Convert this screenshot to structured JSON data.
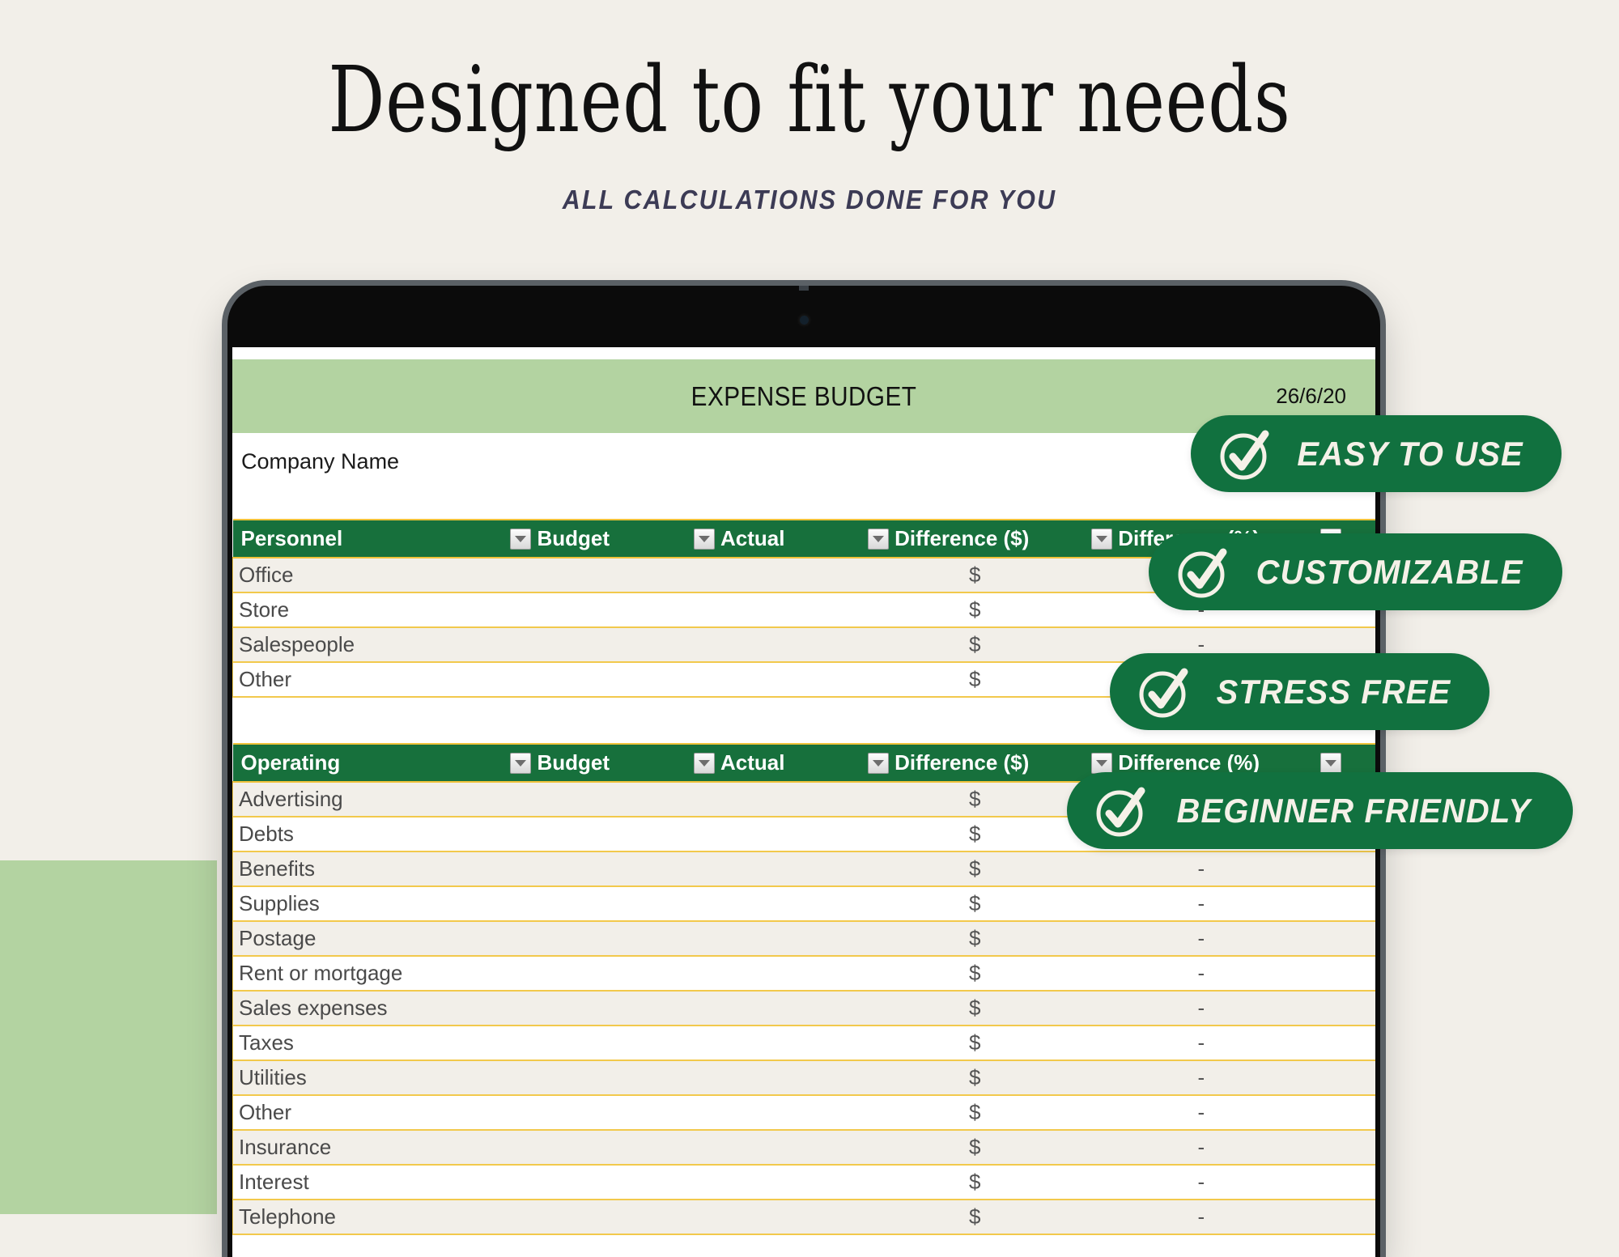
{
  "hero": {
    "headline": "Designed to fit your needs",
    "subhead": "ALL CALCULATIONS DONE FOR YOU"
  },
  "colors": {
    "page_background": "#f2efe9",
    "light_green": "#b3d3a1",
    "dark_green": "#11713f",
    "table_header_green": "#17703c",
    "grid_yellow": "#f2c94c",
    "subhead_navy": "#3c3b55",
    "badge_text": "#f5f1e8"
  },
  "spreadsheet": {
    "title": "EXPENSE BUDGET",
    "date": "26/6/20",
    "company_name": "Company Name",
    "sections": [
      {
        "header": {
          "name": "Personnel",
          "budget": "Budget",
          "actual": "Actual",
          "difference_dollar": "Difference ($)",
          "difference_percent": "Difference (%)"
        },
        "rows": [
          {
            "name": "Office",
            "budget": "",
            "actual": "",
            "diff_d": "$",
            "diff_p": "-"
          },
          {
            "name": "Store",
            "budget": "",
            "actual": "",
            "diff_d": "$",
            "diff_p": "-"
          },
          {
            "name": "Salespeople",
            "budget": "",
            "actual": "",
            "diff_d": "$",
            "diff_p": "-"
          },
          {
            "name": "Other",
            "budget": "",
            "actual": "",
            "diff_d": "$",
            "diff_p": "-"
          }
        ]
      },
      {
        "header": {
          "name": "Operating",
          "budget": "Budget",
          "actual": "Actual",
          "difference_dollar": "Difference ($)",
          "difference_percent": "Difference (%)"
        },
        "rows": [
          {
            "name": "Advertising",
            "budget": "",
            "actual": "",
            "diff_d": "$",
            "diff_p": "-"
          },
          {
            "name": "Debts",
            "budget": "",
            "actual": "",
            "diff_d": "$",
            "diff_p": "-"
          },
          {
            "name": "Benefits",
            "budget": "",
            "actual": "",
            "diff_d": "$",
            "diff_p": "-"
          },
          {
            "name": "Supplies",
            "budget": "",
            "actual": "",
            "diff_d": "$",
            "diff_p": "-"
          },
          {
            "name": "Postage",
            "budget": "",
            "actual": "",
            "diff_d": "$",
            "diff_p": "-"
          },
          {
            "name": "Rent or mortgage",
            "budget": "",
            "actual": "",
            "diff_d": "$",
            "diff_p": "-"
          },
          {
            "name": "Sales expenses",
            "budget": "",
            "actual": "",
            "diff_d": "$",
            "diff_p": "-"
          },
          {
            "name": "Taxes",
            "budget": "",
            "actual": "",
            "diff_d": "$",
            "diff_p": "-"
          },
          {
            "name": "Utilities",
            "budget": "",
            "actual": "",
            "diff_d": "$",
            "diff_p": "-"
          },
          {
            "name": "Other",
            "budget": "",
            "actual": "",
            "diff_d": "$",
            "diff_p": "-"
          },
          {
            "name": "Insurance",
            "budget": "",
            "actual": "",
            "diff_d": "$",
            "diff_p": "-"
          },
          {
            "name": "Interest",
            "budget": "",
            "actual": "",
            "diff_d": "$",
            "diff_p": "-"
          },
          {
            "name": "Telephone",
            "budget": "",
            "actual": "",
            "diff_d": "$",
            "diff_p": "-"
          }
        ]
      }
    ]
  },
  "badges": [
    {
      "label": "EASY TO USE",
      "icon": "check-circle-icon"
    },
    {
      "label": "CUSTOMIZABLE",
      "icon": "check-circle-icon"
    },
    {
      "label": "STRESS FREE",
      "icon": "check-circle-icon"
    },
    {
      "label": "BEGINNER FRIENDLY",
      "icon": "check-circle-icon"
    }
  ]
}
